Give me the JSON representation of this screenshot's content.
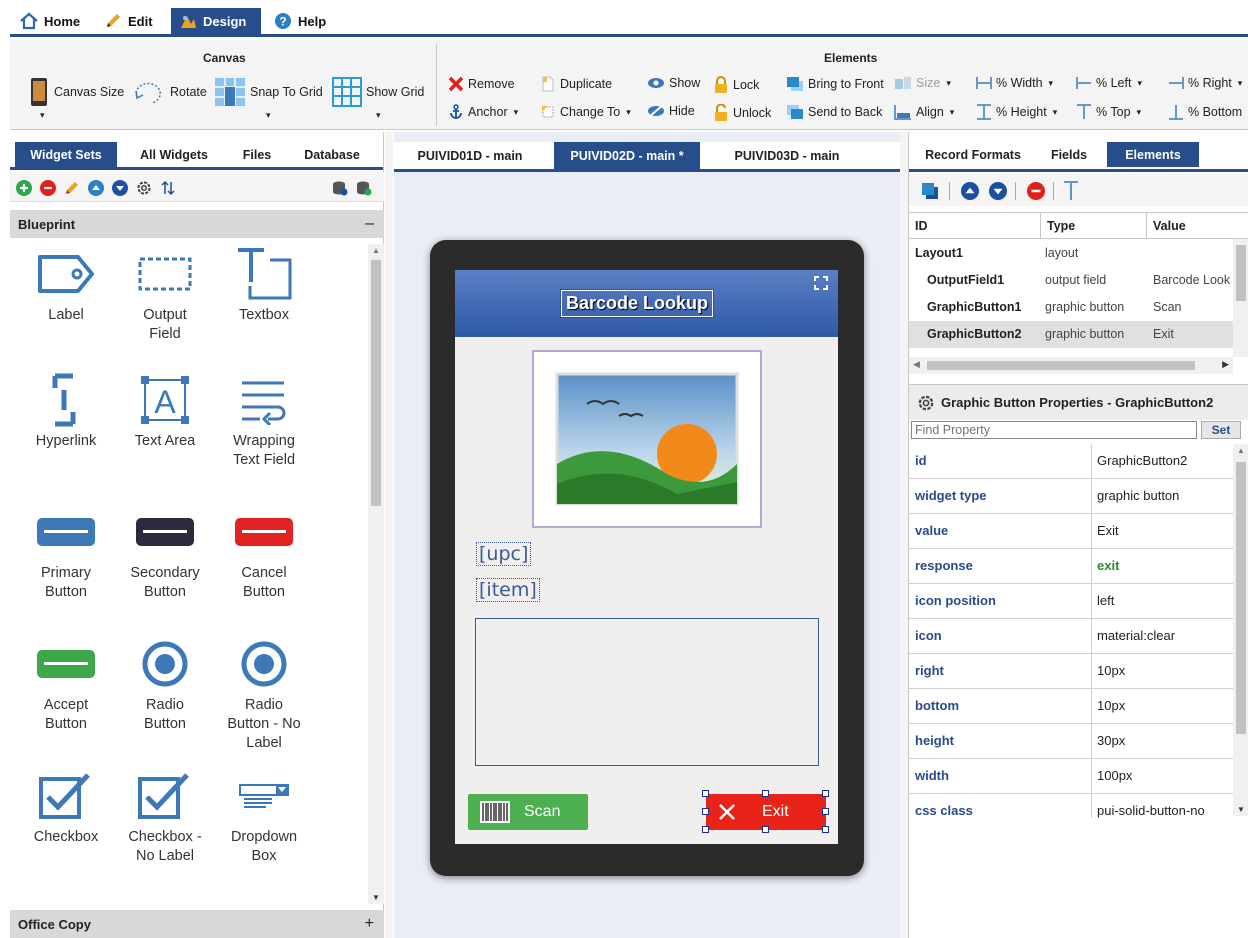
{
  "menu": {
    "home": "Home",
    "edit": "Edit",
    "design": "Design",
    "help": "Help"
  },
  "ribbon": {
    "canvas_title": "Canvas",
    "elements_title": "Elements",
    "canvas_size": "Canvas Size",
    "rotate": "Rotate",
    "snap_to_grid": "Snap To Grid",
    "show_grid": "Show Grid",
    "remove": "Remove",
    "duplicate": "Duplicate",
    "show": "Show",
    "lock": "Lock",
    "bring_to_front": "Bring to Front",
    "size": "Size",
    "pct_width": "% Width",
    "pct_left": "% Left",
    "pct_right": "% Right",
    "anchor": "Anchor",
    "change_to": "Change To",
    "hide": "Hide",
    "unlock": "Unlock",
    "send_to_back": "Send to Back",
    "align": "Align",
    "pct_height": "% Height",
    "pct_top": "% Top",
    "pct_bottom": "% Bottom"
  },
  "left_panel": {
    "tabs": [
      "Widget Sets",
      "All Widgets",
      "Files",
      "Database"
    ],
    "section_blueprint": "Blueprint",
    "section_blueprint_toggle": "–",
    "section_office": "Office Copy",
    "section_office_toggle": "+",
    "widgets": [
      {
        "l1": "Label",
        "l2": ""
      },
      {
        "l1": "Output",
        "l2": "Field"
      },
      {
        "l1": "Textbox",
        "l2": ""
      },
      {
        "l1": "Hyperlink",
        "l2": ""
      },
      {
        "l1": "Text Area",
        "l2": ""
      },
      {
        "l1": "Wrapping",
        "l2": "Text Field"
      },
      {
        "l1": "Primary",
        "l2": "Button"
      },
      {
        "l1": "Secondary",
        "l2": "Button"
      },
      {
        "l1": "Cancel",
        "l2": "Button"
      },
      {
        "l1": "Accept",
        "l2": "Button"
      },
      {
        "l1": "Radio",
        "l2": "Button"
      },
      {
        "l1": "Radio",
        "l2": "Button - No",
        "l3": "Label"
      },
      {
        "l1": "Checkbox",
        "l2": ""
      },
      {
        "l1": "Checkbox -",
        "l2": "No Label"
      },
      {
        "l1": "Dropdown",
        "l2": "Box"
      }
    ]
  },
  "center": {
    "tabs": [
      "PUIVID01D - main",
      "PUIVID02D - main *",
      "PUIVID03D - main"
    ],
    "screen_title": "Barcode Lookup",
    "field_upc": "[upc]",
    "field_item": "[item]",
    "scan_label": "Scan",
    "exit_label": "Exit"
  },
  "right_panel": {
    "tabs": [
      "Record Formats",
      "Fields",
      "Elements"
    ],
    "table_headers": [
      "ID",
      "Type",
      "Value"
    ],
    "rows": [
      {
        "id": "Layout1",
        "type": "layout",
        "value": ""
      },
      {
        "id": "OutputField1",
        "type": "output field",
        "value": "Barcode Look"
      },
      {
        "id": "GraphicButton1",
        "type": "graphic button",
        "value": "Scan"
      },
      {
        "id": "GraphicButton2",
        "type": "graphic button",
        "value": "Exit"
      }
    ],
    "props_title": "Graphic Button Properties - GraphicButton2",
    "find_placeholder": "Find Property",
    "set_label": "Set",
    "properties": [
      {
        "name": "id",
        "value": "GraphicButton2"
      },
      {
        "name": "widget type",
        "value": "graphic button"
      },
      {
        "name": "value",
        "value": "Exit"
      },
      {
        "name": "response",
        "value": "exit"
      },
      {
        "name": "icon position",
        "value": "left"
      },
      {
        "name": "icon",
        "value": "material:clear"
      },
      {
        "name": "right",
        "value": "10px"
      },
      {
        "name": "bottom",
        "value": "10px"
      },
      {
        "name": "height",
        "value": "30px"
      },
      {
        "name": "width",
        "value": "100px"
      },
      {
        "name": "css class",
        "value": "pui-solid-button-no"
      }
    ]
  },
  "colors": {
    "accent": "#274d8a",
    "widget_blue": "#3d78b8",
    "scan_green": "#4caf50",
    "exit_red": "#e8231a"
  }
}
